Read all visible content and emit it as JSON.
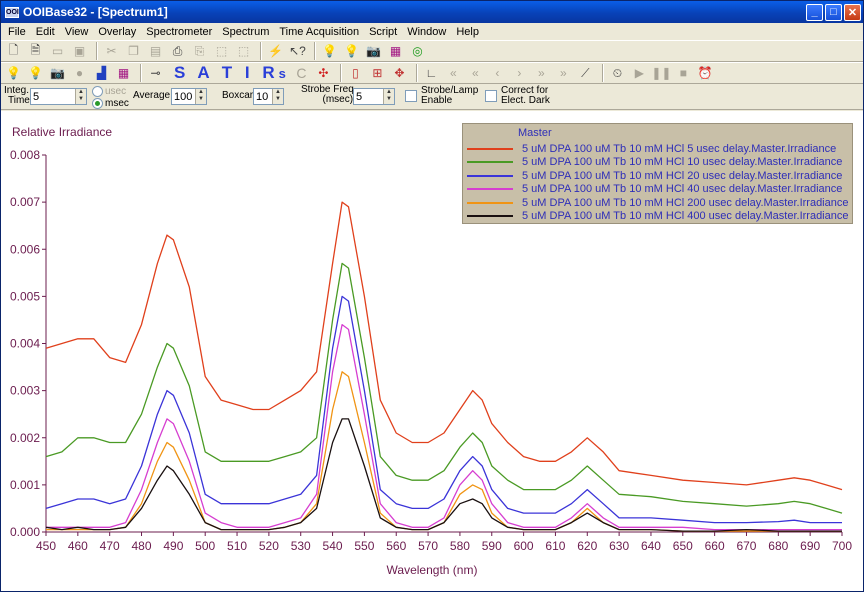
{
  "window": {
    "app_icon": "OOI",
    "title": "OOIBase32 - [Spectrum1]"
  },
  "menu": [
    "File",
    "Edit",
    "View",
    "Overlay",
    "Spectrometer",
    "Spectrum",
    "Time Acquisition",
    "Script",
    "Window",
    "Help"
  ],
  "toolbar": {
    "satir_letters": "S A T I R",
    "satir_sub": "s",
    "c_letter": "C"
  },
  "controls": {
    "integ_label_1": "Integ.",
    "integ_label_2": "Time",
    "integ_value": "5",
    "unit_usec": "usec",
    "unit_msec": "msec",
    "average_label": "Average",
    "average_value": "100",
    "boxcar_label": "Boxcar",
    "boxcar_value": "10",
    "strobe_label_1": "Strobe Freq.",
    "strobe_label_2": "(msec)",
    "strobe_value": "5",
    "strobe_enable_1": "Strobe/Lamp",
    "strobe_enable_2": "Enable",
    "dark_1": "Correct for",
    "dark_2": "Elect. Dark"
  },
  "colors": {
    "plot_bg": "#ffffff",
    "axis": "#6b1c4e",
    "legend_bg": "#c8bfa8",
    "legend_text": "#2e2eb8"
  },
  "chart_data": {
    "type": "line",
    "ylabel": "Relative Irradiance",
    "xlabel": "Wavelength (nm)",
    "xlim": [
      450,
      700
    ],
    "ylim": [
      0,
      0.008
    ],
    "xticks": [
      450,
      460,
      470,
      480,
      490,
      500,
      510,
      520,
      530,
      540,
      550,
      560,
      570,
      580,
      590,
      600,
      610,
      620,
      630,
      640,
      650,
      660,
      670,
      680,
      690,
      700
    ],
    "yticks": [
      "0.000",
      "0.001",
      "0.002",
      "0.003",
      "0.004",
      "0.005",
      "0.006",
      "0.007",
      "0.008"
    ],
    "legend_title": "Master",
    "x": [
      450,
      455,
      460,
      465,
      470,
      475,
      480,
      485,
      488,
      490,
      495,
      500,
      505,
      510,
      515,
      520,
      525,
      530,
      535,
      540,
      543,
      545,
      550,
      555,
      560,
      565,
      570,
      575,
      580,
      584,
      587,
      590,
      595,
      600,
      605,
      610,
      615,
      620,
      625,
      630,
      640,
      650,
      660,
      670,
      680,
      685,
      690,
      695,
      700
    ],
    "series": [
      {
        "name": "5 uM DPA 100 uM Tb 10 mM HCl 5 usec delay.Master.Irradiance",
        "color": "#e0401c",
        "values": [
          0.0039,
          0.004,
          0.0041,
          0.0041,
          0.0037,
          0.0036,
          0.0044,
          0.0057,
          0.0063,
          0.0062,
          0.0052,
          0.0033,
          0.0028,
          0.0027,
          0.0026,
          0.0026,
          0.0028,
          0.003,
          0.0034,
          0.0057,
          0.007,
          0.0069,
          0.005,
          0.0028,
          0.0021,
          0.0019,
          0.0019,
          0.0021,
          0.0026,
          0.003,
          0.0028,
          0.0023,
          0.0019,
          0.0016,
          0.0015,
          0.0015,
          0.0017,
          0.002,
          0.0017,
          0.0013,
          0.0012,
          0.0011,
          0.00105,
          0.001,
          0.0011,
          0.00115,
          0.0011,
          0.001,
          0.0009
        ]
      },
      {
        "name": "5 uM DPA 100 uM Tb 10 mM HCl 10 usec delay.Master.Irradiance",
        "color": "#4a9a24",
        "values": [
          0.0016,
          0.0017,
          0.002,
          0.002,
          0.0019,
          0.0019,
          0.0025,
          0.0035,
          0.004,
          0.0039,
          0.0031,
          0.0017,
          0.0015,
          0.0015,
          0.0015,
          0.0015,
          0.0016,
          0.0017,
          0.002,
          0.0045,
          0.0057,
          0.0056,
          0.0037,
          0.0016,
          0.0012,
          0.0011,
          0.0011,
          0.0013,
          0.0018,
          0.0021,
          0.0019,
          0.0014,
          0.0011,
          0.0009,
          0.0009,
          0.0009,
          0.0011,
          0.0014,
          0.0011,
          0.0008,
          0.00075,
          0.00065,
          0.0006,
          0.00055,
          0.0006,
          0.00065,
          0.0006,
          0.0005,
          0.0004
        ]
      },
      {
        "name": "5 uM DPA 100 uM Tb 10 mM HCl 20 usec delay.Master.Irradiance",
        "color": "#3b34d8",
        "values": [
          0.0005,
          0.0006,
          0.0007,
          0.0007,
          0.0006,
          0.0007,
          0.0014,
          0.0025,
          0.003,
          0.0029,
          0.0021,
          0.0008,
          0.0006,
          0.0006,
          0.0006,
          0.0006,
          0.0007,
          0.0008,
          0.0012,
          0.0039,
          0.005,
          0.0049,
          0.003,
          0.0009,
          0.0006,
          0.0005,
          0.0005,
          0.0007,
          0.0013,
          0.0016,
          0.0014,
          0.0009,
          0.0005,
          0.0004,
          0.0004,
          0.0004,
          0.0006,
          0.0009,
          0.0006,
          0.0003,
          0.0003,
          0.00025,
          0.0002,
          0.0002,
          0.00022,
          0.00025,
          0.0002,
          0.0002,
          0.0002
        ]
      },
      {
        "name": "5 uM DPA 100 uM Tb 10 mM HCl 40 usec delay.Master.Irradiance",
        "color": "#d63ed0",
        "values": [
          0.0001,
          0.0001,
          0.0001,
          0.0001,
          0.0001,
          0.0002,
          0.0009,
          0.0019,
          0.0024,
          0.0023,
          0.0015,
          0.0004,
          0.0002,
          0.0001,
          0.0001,
          0.0001,
          0.0002,
          0.0003,
          0.0008,
          0.0034,
          0.0044,
          0.0043,
          0.0025,
          0.0006,
          0.0002,
          0.0001,
          0.0001,
          0.0003,
          0.001,
          0.0013,
          0.0011,
          0.0006,
          0.0002,
          0.0001,
          0.0001,
          0.0001,
          0.0003,
          0.0006,
          0.0003,
          0.0001,
          0.0001,
          0.0001,
          5e-05,
          5e-05,
          5e-05,
          5e-05,
          5e-05,
          5e-05,
          5e-05
        ]
      },
      {
        "name": "5 uM DPA 100 uM Tb 10 mM HCl 200 usec delay.Master.Irradiance",
        "color": "#f09414",
        "values": [
          5e-05,
          5e-05,
          5e-05,
          5e-05,
          5e-05,
          0.0001,
          0.0006,
          0.0015,
          0.0019,
          0.0018,
          0.0011,
          0.0002,
          5e-05,
          5e-05,
          5e-05,
          5e-05,
          0.0001,
          0.0002,
          0.0006,
          0.0026,
          0.0034,
          0.0033,
          0.0019,
          0.0004,
          0.0001,
          5e-05,
          5e-05,
          0.0002,
          0.0008,
          0.001,
          0.0009,
          0.0004,
          0.0001,
          5e-05,
          5e-05,
          5e-05,
          0.0002,
          0.0005,
          0.0002,
          5e-05,
          5e-05,
          2e-05,
          2e-05,
          2e-05,
          2e-05,
          2e-05,
          2e-05,
          2e-05,
          2e-05
        ]
      },
      {
        "name": "5 uM DPA 100 uM Tb 10 mM HCl 400 usec delay.Master.Irradiance",
        "color": "#1a1010",
        "values": [
          0.0001,
          5e-05,
          0.0001,
          5e-05,
          5e-05,
          0.0001,
          0.0005,
          0.0011,
          0.0014,
          0.0013,
          0.0008,
          0.0002,
          5e-05,
          5e-05,
          5e-05,
          5e-05,
          0.0001,
          0.0002,
          0.0005,
          0.0019,
          0.0024,
          0.0024,
          0.0014,
          0.0003,
          0.0001,
          5e-05,
          5e-05,
          0.0002,
          0.0006,
          0.0007,
          0.0006,
          0.0003,
          0.0001,
          5e-05,
          5e-05,
          5e-05,
          0.0002,
          0.0004,
          0.0002,
          5e-05,
          5e-05,
          2e-05,
          2e-05,
          5e-05,
          2e-05,
          2e-05,
          2e-05,
          2e-05,
          2e-05
        ]
      }
    ]
  }
}
